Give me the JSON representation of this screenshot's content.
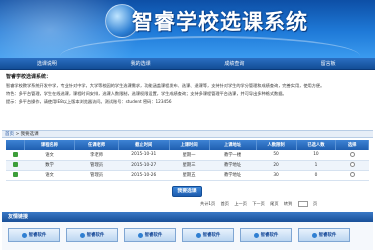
{
  "banner": {
    "title": "智睿学校选课系统"
  },
  "nav": {
    "items": [
      "选课说明",
      "我的选课",
      "成绩查询",
      "留言板"
    ]
  },
  "notice": {
    "title": "智睿学校选课系统：",
    "lines": [
      "智睿学校教学系统开发中学，专业针对中学，大学等校园的学生选课需求，功能涵盖课程发布、选课、退课等，支持针对学生的学分管理和成绩查询，完善实用，使用方便。",
      "特色：多平台管理，学生在线选课，课程时间安排，选课人数限制，选课权限设置，学生成绩查询；支持多课程管理平台选课，并可导出多种格式数据。",
      "提示：多平台操作，请使用IE8以上版本浏览器访问。测试账号：student 密码：123456"
    ]
  },
  "path": {
    "home": "首页",
    "current": "我要选课"
  },
  "table": {
    "headers": [
      "",
      "课程名称",
      "任课老师",
      "截止时间",
      "上课时间",
      "上课地址",
      "人数限制",
      "已选人数",
      "选择"
    ],
    "rows": [
      {
        "course": "语文",
        "teacher": "李老师",
        "deadline": "2015-10-31",
        "time": "星期一",
        "place": "教学一楼",
        "limit": "50",
        "chosen": "10"
      },
      {
        "course": "数学",
        "teacher": "管理员",
        "deadline": "2015-10-27",
        "time": "星期三",
        "place": "教学地址",
        "limit": "20",
        "chosen": "1"
      },
      {
        "course": "语文",
        "teacher": "管理员",
        "deadline": "2015-10-26",
        "time": "星期五",
        "place": "教学地址",
        "limit": "30",
        "chosen": "0"
      }
    ]
  },
  "submit_label": "我要选课",
  "pager": {
    "total": "共计1页",
    "first": "首页",
    "prev": "上一页",
    "next": "下一页",
    "last": "尾页",
    "goto": "转到",
    "page": "页"
  },
  "links": {
    "title": "友情链接",
    "items": [
      "智睿软件",
      "智睿软件",
      "智睿软件",
      "智睿软件",
      "智睿软件",
      "智睿软件"
    ]
  }
}
